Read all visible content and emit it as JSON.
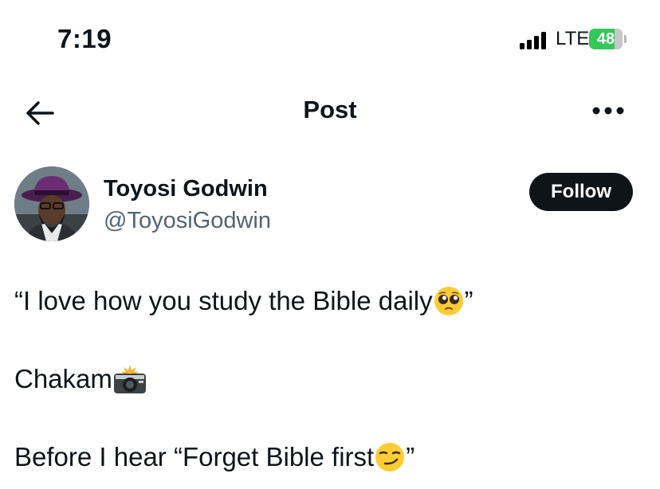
{
  "status_bar": {
    "time": "7:19",
    "network": "LTE",
    "battery": "48"
  },
  "nav": {
    "title": "Post"
  },
  "author": {
    "name": "Toyosi Godwin",
    "handle": "@ToyosiGodwin",
    "follow_label": "Follow"
  },
  "post": {
    "line1_text": "“I love how you study the Bible daily ",
    "line1_end": "”",
    "line1_emoji": "pleading-face-icon",
    "line2_text": "Chakam ",
    "line2_emoji": "camera-with-flash-icon",
    "line3_text": "Before I hear “Forget Bible first",
    "line3_end": "”",
    "line3_emoji": "smirking-face-icon"
  }
}
